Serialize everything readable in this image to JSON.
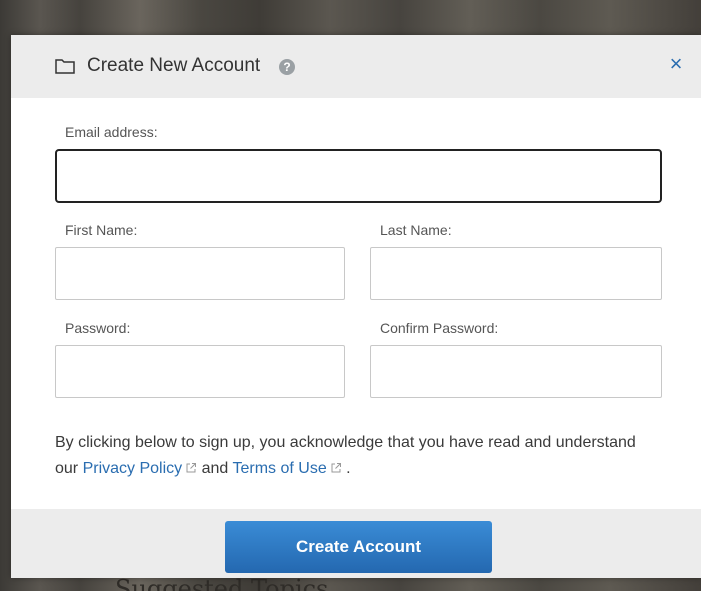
{
  "background": {
    "partial_text": "Suggested Topics"
  },
  "modal": {
    "title": "Create New Account",
    "help_icon": "help-icon",
    "close_label": "×",
    "colors": {
      "header_bg": "#ececec",
      "link": "#2a6db0",
      "primary_button": "#2a74c0"
    }
  },
  "form": {
    "email_label": "Email address:",
    "email_value": "",
    "first_name_label": "First Name:",
    "first_name_value": "",
    "last_name_label": "Last Name:",
    "last_name_value": "",
    "password_label": "Password:",
    "password_value": "",
    "confirm_password_label": "Confirm Password:",
    "confirm_password_value": ""
  },
  "acknowledgement": {
    "text_before": "By clicking below to sign up, you acknowledge that you have read and understand our",
    "privacy_link": "Privacy Policy",
    "text_between": "and",
    "terms_link": "Terms of Use",
    "text_after": "."
  },
  "footer": {
    "submit_label": "Create Account"
  }
}
